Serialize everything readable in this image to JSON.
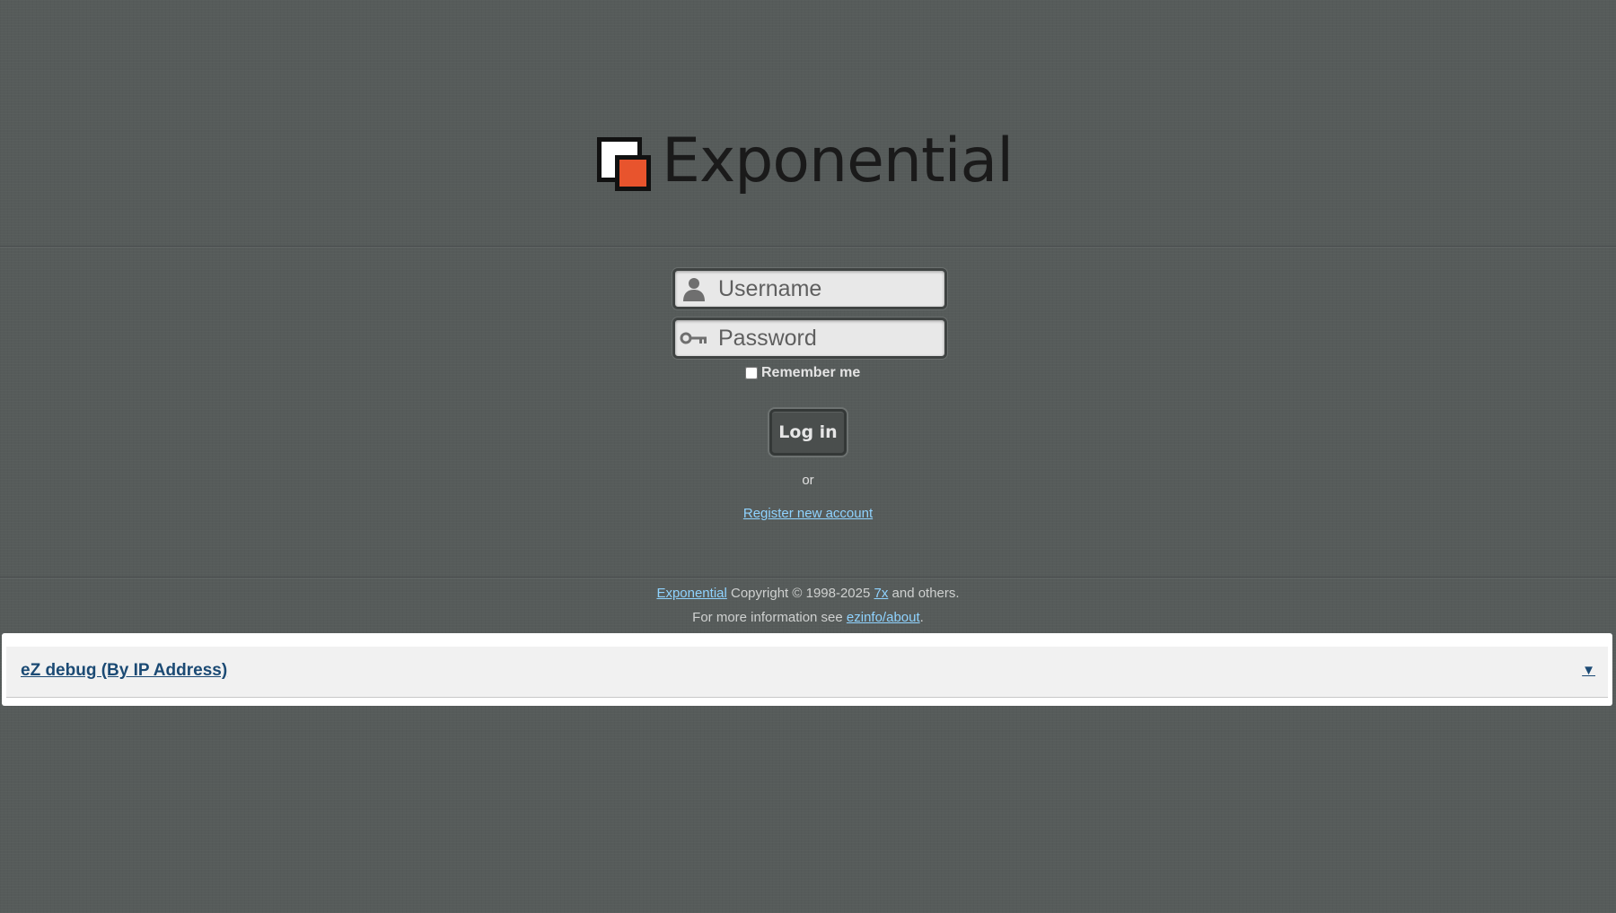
{
  "brand": {
    "name": "Exponential",
    "colors": {
      "accent": "#e8542d",
      "link": "#8fd3ff",
      "debug_link": "#1b4a74"
    }
  },
  "login": {
    "username": {
      "placeholder": "Username",
      "value": "",
      "icon": "user-icon"
    },
    "password": {
      "placeholder": "Password",
      "value": "",
      "icon": "key-icon"
    },
    "remember_label": "Remember me",
    "remember_checked": false,
    "submit_label": "Log in",
    "or_text": "or",
    "register_link": "Register new account"
  },
  "footer": {
    "line1": {
      "product_link": "Exponential",
      "copyright": " Copyright © 1998-2025 ",
      "org_link": "7x",
      "suffix": " and others."
    },
    "line2": {
      "prefix": "For more information see ",
      "link": "ezinfo/about",
      "suffix": "."
    }
  },
  "debug": {
    "title": "eZ debug (By IP Address)",
    "toggle": "▼"
  }
}
